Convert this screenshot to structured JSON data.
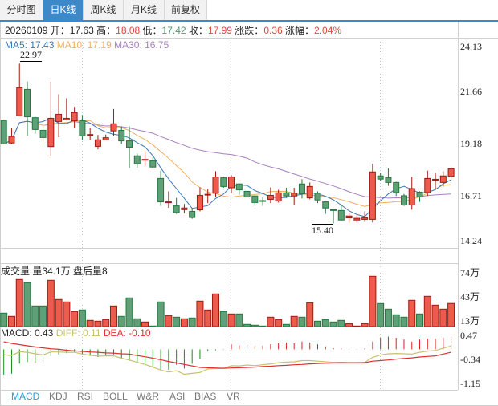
{
  "tabs": [
    {
      "label": "分时图",
      "active": false
    },
    {
      "label": "日K线",
      "active": true
    },
    {
      "label": "周K线",
      "active": false
    },
    {
      "label": "月K线",
      "active": false
    },
    {
      "label": "前复权",
      "active": false
    }
  ],
  "info": {
    "date": "20260109",
    "open_label": "开：",
    "open": "17.63",
    "high_label": "高：",
    "high": "18.08",
    "low_label": "低：",
    "low": "17.42",
    "close_label": "收：",
    "close": "17.99",
    "change_label": "涨跌：",
    "change": "0.36",
    "pct_label": "涨幅：",
    "pct": "2.04%"
  },
  "ma_legend": {
    "ma5": "MA5: 17.43",
    "ma10": "MA10: 17.19",
    "ma30": "MA30: 16.75"
  },
  "price_axis": [
    "24.13",
    "21.66",
    "19.18",
    "16.71",
    "14.24"
  ],
  "annotations": {
    "max": "22.97",
    "min": "15.40"
  },
  "volume": {
    "label": "成交量 量34.1万 盘后量8",
    "axis": [
      "74万",
      "43万",
      "13万"
    ]
  },
  "macd": {
    "macd_label": "MACD: 0.43",
    "diff_label": "DIFF: 0.11",
    "dea_label": "DEA: -0.10",
    "axis": [
      "0.47",
      "-0.34",
      "-1.15"
    ]
  },
  "indicator_tabs": [
    {
      "label": "MACD",
      "active": true
    },
    {
      "label": "KDJ"
    },
    {
      "label": "RSI"
    },
    {
      "label": "BOLL"
    },
    {
      "label": "W&R"
    },
    {
      "label": "ASI"
    },
    {
      "label": "BIAS"
    },
    {
      "label": "VR"
    }
  ],
  "colors": {
    "up": "#ec5b4b",
    "up_border": "#a01a12",
    "down": "#5fa078",
    "down_border": "#1f7a3c",
    "ma5": "#3a78b0",
    "ma10": "#f0b060",
    "ma30": "#a87fc0",
    "diff": "#c8c070",
    "dea": "#e03030",
    "accent": "#3d88c8"
  },
  "chart_data": {
    "type": "candlestick",
    "price_range": [
      14.24,
      24.13
    ],
    "ohlc": [
      [
        20.28,
        20.31,
        19.14,
        19.17
      ],
      [
        19.21,
        19.9,
        19.17,
        19.52
      ],
      [
        20.5,
        22.97,
        20.48,
        21.83
      ],
      [
        21.75,
        22.12,
        19.55,
        20.45
      ],
      [
        20.41,
        20.45,
        19.65,
        19.85
      ],
      [
        19.81,
        20.0,
        19.12,
        19.47
      ],
      [
        19.04,
        22.12,
        18.57,
        20.38
      ],
      [
        20.23,
        21.52,
        19.48,
        20.57
      ],
      [
        20.31,
        21.33,
        20.28,
        20.38
      ],
      [
        20.26,
        20.92,
        19.9,
        20.65
      ],
      [
        20.26,
        20.54,
        19.36,
        19.55
      ],
      [
        19.57,
        19.94,
        19.36,
        19.61
      ],
      [
        19.05,
        19.59,
        18.91,
        19.36
      ],
      [
        19.36,
        19.61,
        19.36,
        19.46
      ],
      [
        19.78,
        20.82,
        19.55,
        20.12
      ],
      [
        19.81,
        20.0,
        19.17,
        19.31
      ],
      [
        19.31,
        20.0,
        18.03,
        19.01
      ],
      [
        18.6,
        18.7,
        18.03,
        18.23
      ],
      [
        18.41,
        18.83,
        18.13,
        18.43
      ],
      [
        18.37,
        18.55,
        18.03,
        18.07
      ],
      [
        17.53,
        17.9,
        16.23,
        16.42
      ],
      [
        16.38,
        16.92,
        16.14,
        16.42
      ],
      [
        16.23,
        16.61,
        15.85,
        15.91
      ],
      [
        16.05,
        16.32,
        15.88,
        16.13
      ],
      [
        15.97,
        16.13,
        15.62,
        15.68
      ],
      [
        16.04,
        17.11,
        15.97,
        16.73
      ],
      [
        16.75,
        17.03,
        16.36,
        16.78
      ],
      [
        16.83,
        17.87,
        16.67,
        17.6
      ],
      [
        17.56,
        17.6,
        17.09,
        17.15
      ],
      [
        17.09,
        17.68,
        16.82,
        17.6
      ],
      [
        17.27,
        17.3,
        16.76,
        16.99
      ],
      [
        16.92,
        16.95,
        16.61,
        16.65
      ],
      [
        16.7,
        16.72,
        16.23,
        16.39
      ],
      [
        16.48,
        16.67,
        16.23,
        16.47
      ],
      [
        16.54,
        17.11,
        16.36,
        16.73
      ],
      [
        16.46,
        16.99,
        16.39,
        16.85
      ],
      [
        16.85,
        17.09,
        16.61,
        16.7
      ],
      [
        16.7,
        17.09,
        16.25,
        16.83
      ],
      [
        17.27,
        17.5,
        16.58,
        16.8
      ],
      [
        16.61,
        17.34,
        16.54,
        17.15
      ],
      [
        16.83,
        16.92,
        16.36,
        16.51
      ],
      [
        16.42,
        16.48,
        15.85,
        16.13
      ],
      [
        16.05,
        16.1,
        15.4,
        16.01
      ],
      [
        16.01,
        16.28,
        15.53,
        15.56
      ],
      [
        15.66,
        15.91,
        15.44,
        15.75
      ],
      [
        15.56,
        15.78,
        15.44,
        15.64
      ],
      [
        15.59,
        15.97,
        15.47,
        15.66
      ],
      [
        15.59,
        18.22,
        15.44,
        17.84
      ],
      [
        17.65,
        17.81,
        17.43,
        17.5
      ],
      [
        17.57,
        18.0,
        17.18,
        17.34
      ],
      [
        17.34,
        17.37,
        16.7,
        16.86
      ],
      [
        16.71,
        16.8,
        16.23,
        16.27
      ],
      [
        16.27,
        17.6,
        16.05,
        17.05
      ],
      [
        16.88,
        16.92,
        16.42,
        16.66
      ],
      [
        16.86,
        17.9,
        16.7,
        17.53
      ],
      [
        17.46,
        17.79,
        17.03,
        17.49
      ],
      [
        17.34,
        17.87,
        17.14,
        17.65
      ],
      [
        17.63,
        18.08,
        17.42,
        17.99
      ]
    ],
    "volume_wan": [
      22,
      18,
      64,
      60,
      31,
      31,
      63,
      39,
      36,
      24,
      26,
      13,
      12,
      14,
      31,
      18,
      41,
      15,
      11,
      6,
      36,
      19,
      17,
      15,
      16,
      37,
      26,
      46,
      24,
      21,
      21,
      8,
      7,
      6,
      17,
      14,
      8,
      18,
      17,
      35,
      12,
      14,
      11,
      13,
      9,
      6,
      9,
      68,
      34,
      27,
      20,
      17,
      38,
      21,
      43,
      32,
      27,
      34.1
    ],
    "macd_hist": [
      -0.85,
      -0.82,
      -0.48,
      -0.43,
      -0.46,
      -0.48,
      -0.22,
      -0.17,
      -0.13,
      -0.09,
      -0.17,
      -0.22,
      -0.26,
      -0.2,
      -0.17,
      -0.3,
      -0.39,
      -0.46,
      -0.52,
      -0.59,
      -0.69,
      -0.69,
      -0.52,
      -0.65,
      -0.49,
      -0.33,
      -0.07,
      -0.03,
      0.01,
      0.17,
      0.13,
      0.16,
      0.1,
      0.13,
      0.17,
      0.2,
      0.23,
      0.2,
      0.26,
      0.23,
      0.17,
      0.1,
      0.04,
      0.03,
      0.01,
      0.01,
      0.03,
      0.26,
      0.39,
      0.43,
      0.39,
      0.33,
      0.26,
      0.33,
      0.36,
      0.36,
      0.39,
      0.43
    ],
    "diff": [
      -0.18,
      -0.21,
      -0.08,
      -0.1,
      -0.15,
      -0.19,
      -0.09,
      -0.09,
      -0.1,
      -0.1,
      -0.16,
      -0.2,
      -0.23,
      -0.22,
      -0.22,
      -0.3,
      -0.36,
      -0.44,
      -0.51,
      -0.6,
      -0.7,
      -0.76,
      -0.72,
      -0.84,
      -0.81,
      -0.78,
      -0.66,
      -0.65,
      -0.64,
      -0.55,
      -0.56,
      -0.53,
      -0.55,
      -0.52,
      -0.49,
      -0.45,
      -0.43,
      -0.42,
      -0.38,
      -0.38,
      -0.4,
      -0.42,
      -0.44,
      -0.44,
      -0.45,
      -0.45,
      -0.44,
      -0.27,
      -0.19,
      -0.15,
      -0.14,
      -0.15,
      -0.16,
      -0.1,
      -0.06,
      -0.04,
      0.04,
      0.11
    ],
    "dea": [
      0.25,
      0.2,
      0.16,
      0.12,
      0.08,
      0.05,
      0.02,
      0.0,
      -0.03,
      -0.05,
      -0.07,
      -0.09,
      -0.1,
      -0.12,
      -0.13,
      -0.15,
      -0.16,
      -0.21,
      -0.25,
      -0.3,
      -0.35,
      -0.41,
      -0.46,
      -0.51,
      -0.56,
      -0.61,
      -0.62,
      -0.63,
      -0.64,
      -0.63,
      -0.62,
      -0.61,
      -0.6,
      -0.58,
      -0.57,
      -0.55,
      -0.54,
      -0.52,
      -0.51,
      -0.49,
      -0.48,
      -0.47,
      -0.46,
      -0.45,
      -0.45,
      -0.45,
      -0.45,
      -0.4,
      -0.38,
      -0.36,
      -0.33,
      -0.31,
      -0.29,
      -0.26,
      -0.24,
      -0.22,
      -0.16,
      -0.1
    ]
  }
}
